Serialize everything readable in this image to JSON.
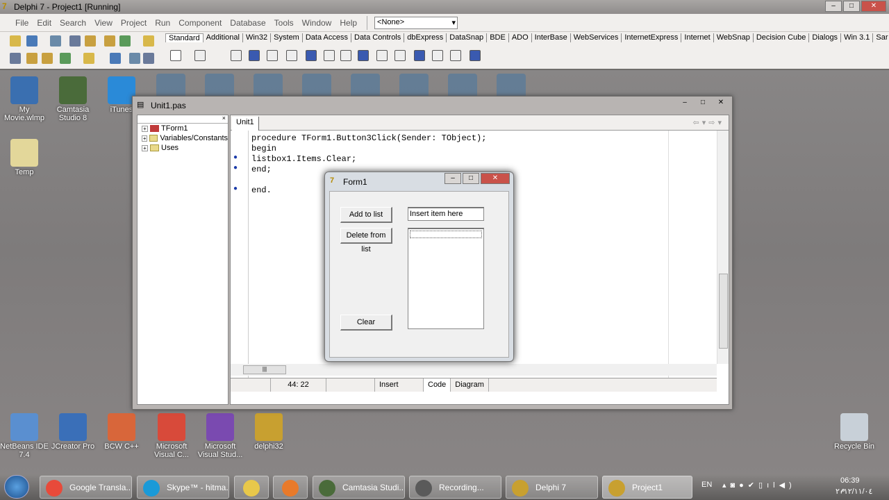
{
  "ide": {
    "title": "Delphi 7 - Project1 [Running]",
    "menu": [
      "File",
      "Edit",
      "Search",
      "View",
      "Project",
      "Run",
      "Component",
      "Database",
      "Tools",
      "Window",
      "Help"
    ],
    "combo_value": "<None>",
    "palette_tabs": [
      "Standard",
      "Additional",
      "Win32",
      "System",
      "Data Access",
      "Data Controls",
      "dbExpress",
      "DataSnap",
      "BDE",
      "ADO",
      "InterBase",
      "WebServices",
      "InternetExpress",
      "Internet",
      "WebSnap",
      "Decision Cube",
      "Dialogs",
      "Win 3.1",
      "Sar"
    ]
  },
  "desktop_icons": [
    {
      "label": "My Movie.wlmp",
      "color": "#3a6fb0"
    },
    {
      "label": "Camtasia Studio 8",
      "color": "#4a6b3a"
    },
    {
      "label": "iTunes",
      "color": "#2a8ad8"
    },
    {
      "label": "Temp",
      "color": "#e3d79a"
    },
    {
      "label": "NetBeans IDE 7.4",
      "color": "#5a8fd0"
    },
    {
      "label": "JCreator Pro",
      "color": "#3a6fb8"
    },
    {
      "label": "BCW C++",
      "color": "#d8663a"
    },
    {
      "label": "Microsoft Visual C...",
      "color": "#d84a3a"
    },
    {
      "label": "Microsoft Visual Stud...",
      "color": "#7a4ab0"
    },
    {
      "label": "delphi32",
      "color": "#c8a030"
    },
    {
      "label": "Recycle Bin",
      "color": "#c8d0d8"
    }
  ],
  "unit_window": {
    "title": "Unit1.pas",
    "tree": [
      "TForm1",
      "Variables/Constants",
      "Uses"
    ],
    "tab": "Unit1",
    "code": [
      {
        "text": "procedure TForm1.Button3Click(Sender: TObject);",
        "dot": false
      },
      {
        "text": "begin",
        "dot": false
      },
      {
        "text": "listbox1.Items.Clear;",
        "dot": true
      },
      {
        "text": "end;",
        "dot": true
      },
      {
        "text": "",
        "dot": false
      },
      {
        "text": "end.",
        "dot": true
      }
    ],
    "status": {
      "position": "44: 22",
      "mode": "Insert",
      "tabs": [
        "Code",
        "Diagram"
      ]
    }
  },
  "form1": {
    "title": "Form1",
    "add_button": "Add to list",
    "delete_button": "Delete from list",
    "clear_button": "Clear",
    "edit_value": "Insert item here"
  },
  "taskbar": {
    "items": [
      "Google Transla...",
      "Skype™ - hitma...",
      "",
      "",
      "Camtasia Studi...",
      "Recording...",
      "Delphi 7",
      "Project1"
    ],
    "lang": "EN",
    "time": "06:39 م",
    "date": "٢٠١٢/١١/٠٤"
  }
}
